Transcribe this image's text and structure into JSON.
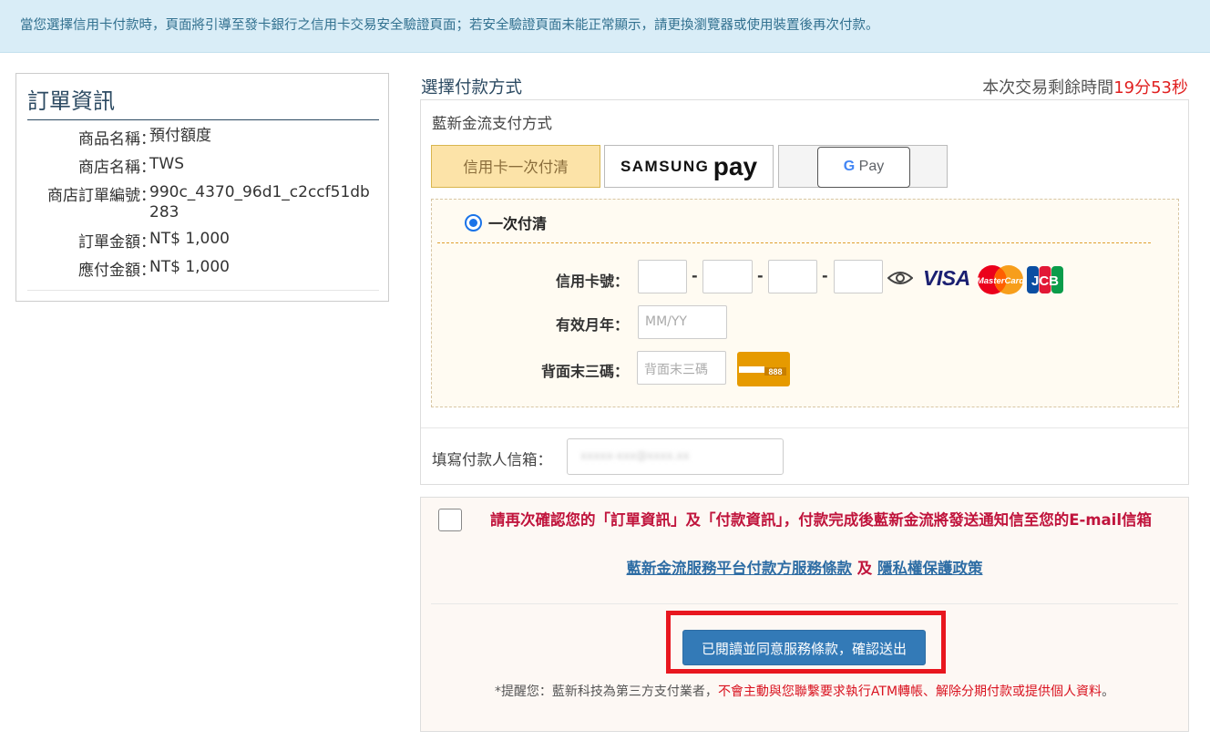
{
  "notice": "當您選擇信用卡付款時，頁面將引導至發卡銀行之信用卡交易安全驗證頁面；若安全驗證頁面未能正常顯示，請更換瀏覽器或使用裝置後再次付款。",
  "order": {
    "title": "訂單資訊",
    "rows": [
      {
        "label": "商品名稱：",
        "value": "預付額度"
      },
      {
        "label": "商店名稱：",
        "value": "TWS"
      },
      {
        "label": "商店訂單編號：",
        "value": "990c_4370_96d1_c2ccf51db283"
      },
      {
        "label": "訂單金額：",
        "value": "NT$ 1,000"
      },
      {
        "label": "應付金額：",
        "value": "NT$ 1,000"
      }
    ]
  },
  "payment": {
    "title": "選擇付款方式",
    "timer_prefix": "本次交易剩餘時間",
    "timer_minutes": "19分",
    "timer_seconds": "53秒",
    "provider_label": "藍新金流支付方式",
    "tabs": {
      "credit": "信用卡一次付清",
      "samsung_a": "SAMSUNG",
      "samsung_b": "pay",
      "gpay_g": "G",
      "gpay_pay": " Pay"
    },
    "option_label": "一次付清",
    "card_number_label": "信用卡號：",
    "dash": "-",
    "expiry_label": "有效月年：",
    "expiry_placeholder": "MM/YY",
    "cvc_label": "背面末三碼：",
    "cvc_placeholder": "背面末三碼",
    "cvc_sample": "888",
    "brands": {
      "visa": "VISA",
      "mastercard": "MasterCard",
      "jcb": "JCB"
    },
    "email_label": "填寫付款人信箱：",
    "email_value": "xxxxx-xxx@xxxx.xx"
  },
  "confirm": {
    "text": "請再次確認您的「訂單資訊」及「付款資訊」，付款完成後藍新金流將發送通知信至您的E-mail信箱",
    "link_terms": "藍新金流服務平台付款方服務條款",
    "and": " 及 ",
    "link_privacy": "隱私權保護政策",
    "submit": "已閱讀並同意服務條款，確認送出",
    "remind_a": "*提醒您：藍新科技為第三方支付業者，",
    "remind_b": "不會主動與您聯繫",
    "remind_c": "要求執行ATM轉帳、解除分期付款或提供個人資料",
    "remind_d": "。"
  },
  "colors": {
    "accent": "#337ab7",
    "alert": "#c0143c",
    "highlight": "#e8171f",
    "notice_bg": "#d9edf7"
  }
}
